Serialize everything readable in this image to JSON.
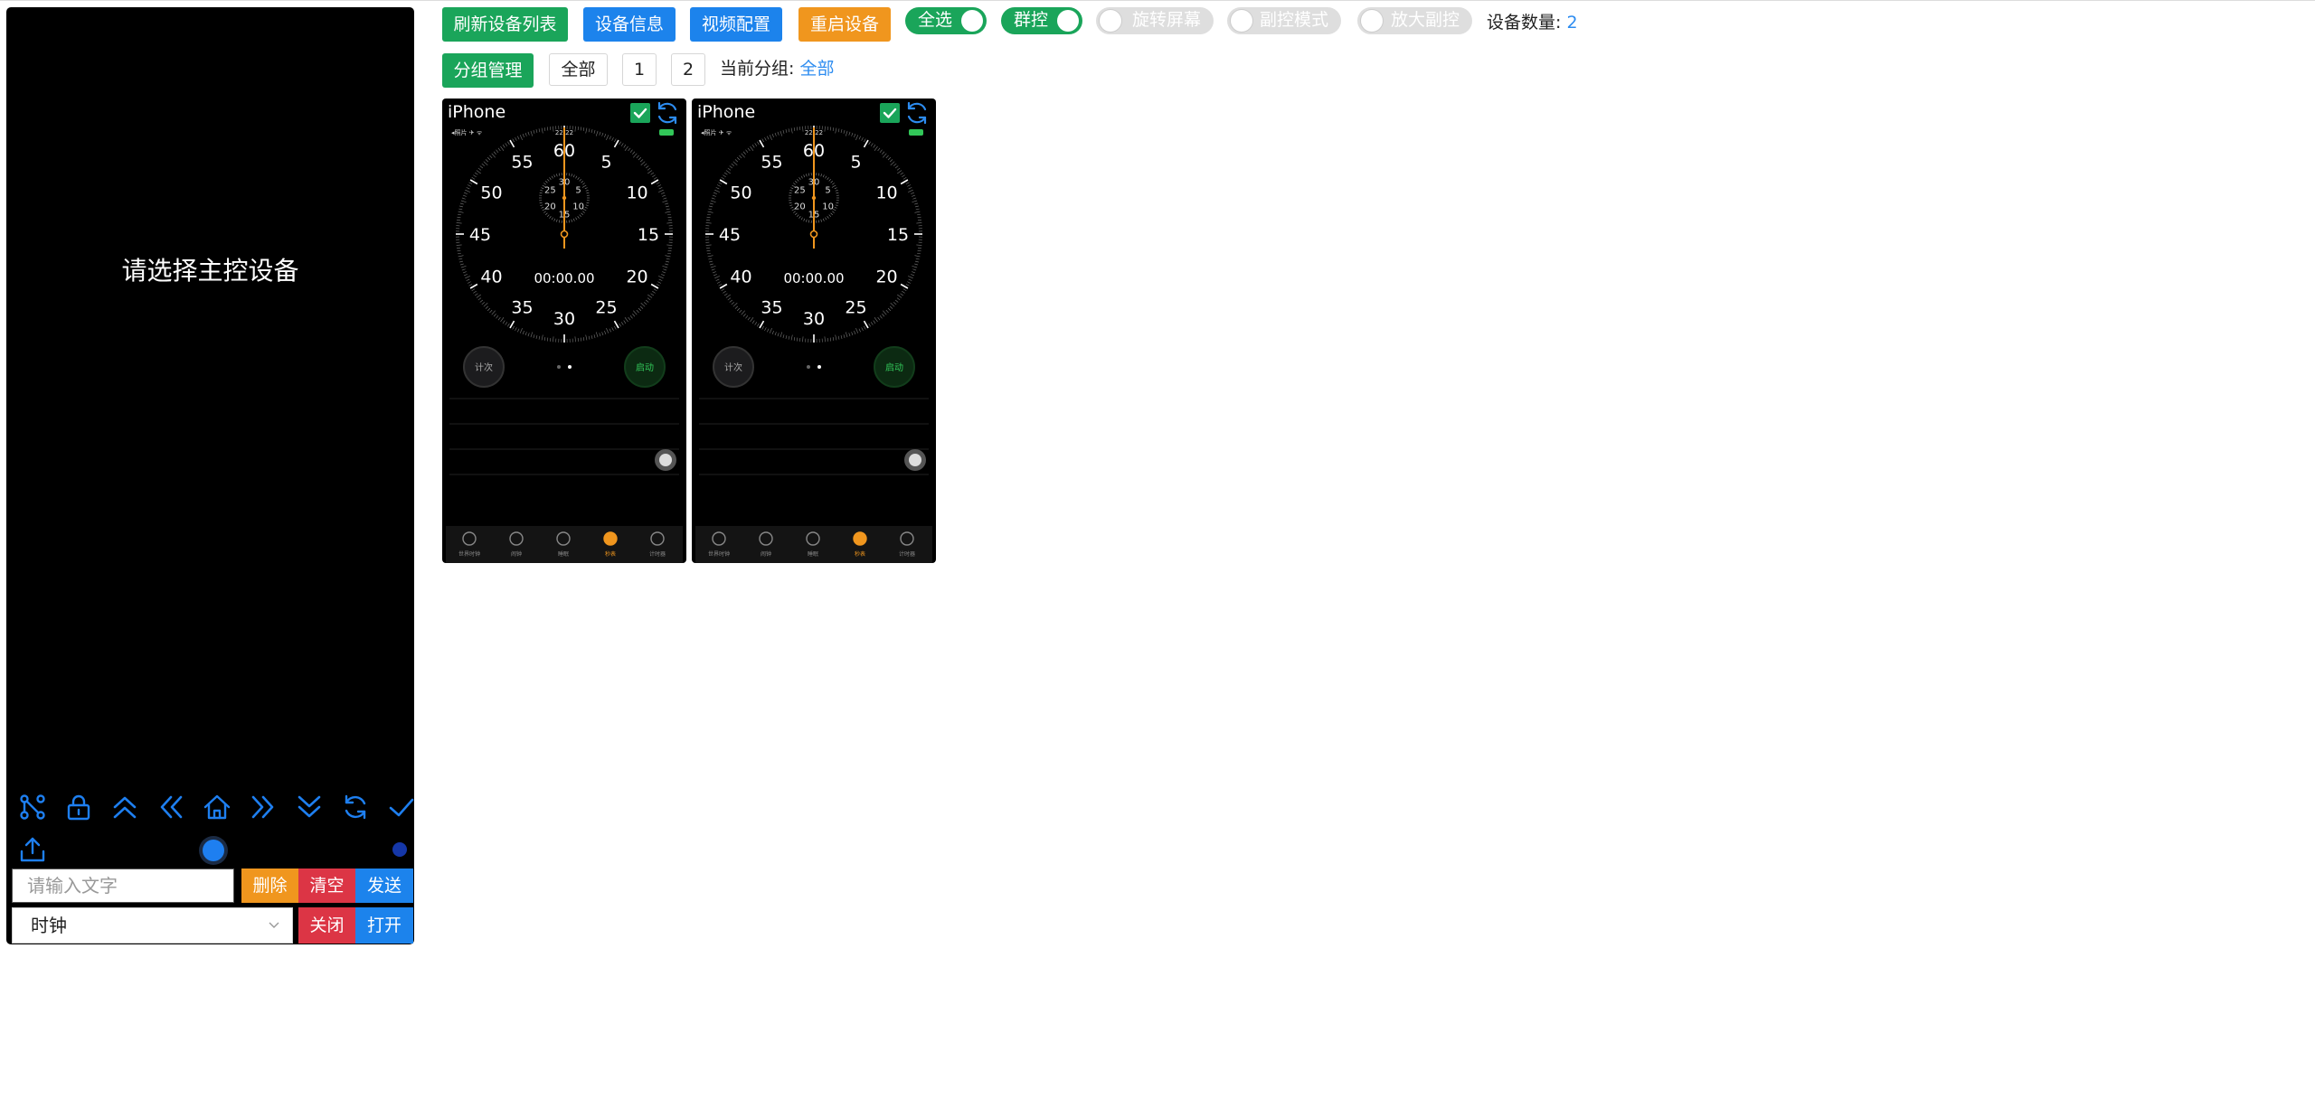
{
  "master": {
    "placeholder_message": "请选择主控设备",
    "controls": [
      {
        "name": "nodes-icon"
      },
      {
        "name": "lock-icon"
      },
      {
        "name": "double-up-icon"
      },
      {
        "name": "double-left-icon"
      },
      {
        "name": "home-icon"
      },
      {
        "name": "double-right-icon"
      },
      {
        "name": "double-down-icon"
      },
      {
        "name": "refresh-icon"
      },
      {
        "name": "check-icon"
      }
    ],
    "text_input": {
      "placeholder": "请输入文字",
      "value": ""
    },
    "delete_label": "删除",
    "clear_label": "清空",
    "send_label": "发送",
    "app_select": {
      "value": "时钟"
    },
    "close_label": "关闭",
    "open_label": "打开"
  },
  "toolbar": {
    "refresh_devices": "刷新设备列表",
    "device_info": "设备信息",
    "video_config": "视频配置",
    "restart_device": "重启设备",
    "select_all": {
      "label": "全选",
      "on": true
    },
    "group_control": {
      "label": "群控",
      "on": true
    },
    "rotate_screen": {
      "label": "旋转屏幕",
      "on": false
    },
    "sub_control_mode": {
      "label": "副控模式",
      "on": false
    },
    "zoom_sub_control": {
      "label": "放大副控",
      "on": false
    },
    "device_count_label": "设备数量:",
    "device_count": "2"
  },
  "groups": {
    "manage_label": "分组管理",
    "items": [
      "全部",
      "1",
      "2"
    ],
    "current_label": "当前分组:",
    "current_value": "全部"
  },
  "devices": [
    {
      "title": "iPhone",
      "checked": true
    },
    {
      "title": "iPhone",
      "checked": true
    }
  ],
  "phone_screen": {
    "status_left": "◂照片 ✈ ᯤ",
    "status_time": "22:22",
    "dial_numbers": [
      "60",
      "5",
      "10",
      "15",
      "20",
      "25",
      "30",
      "35",
      "40",
      "45",
      "50",
      "55"
    ],
    "sub_dial_numbers": [
      "30",
      "5",
      "10",
      "15",
      "20",
      "25"
    ],
    "timer": "00:00.00",
    "lap_label": "计次",
    "start_label": "启动",
    "tabs": [
      "世界时钟",
      "闹钟",
      "睡眠",
      "秒表",
      "计时器"
    ]
  },
  "colors": {
    "green": "#1aa55a",
    "blue": "#1c83ec",
    "orange": "#f0961e",
    "red": "#dc3545",
    "link": "#2d8cf0",
    "stopwatch_hand": "#f0961e"
  }
}
